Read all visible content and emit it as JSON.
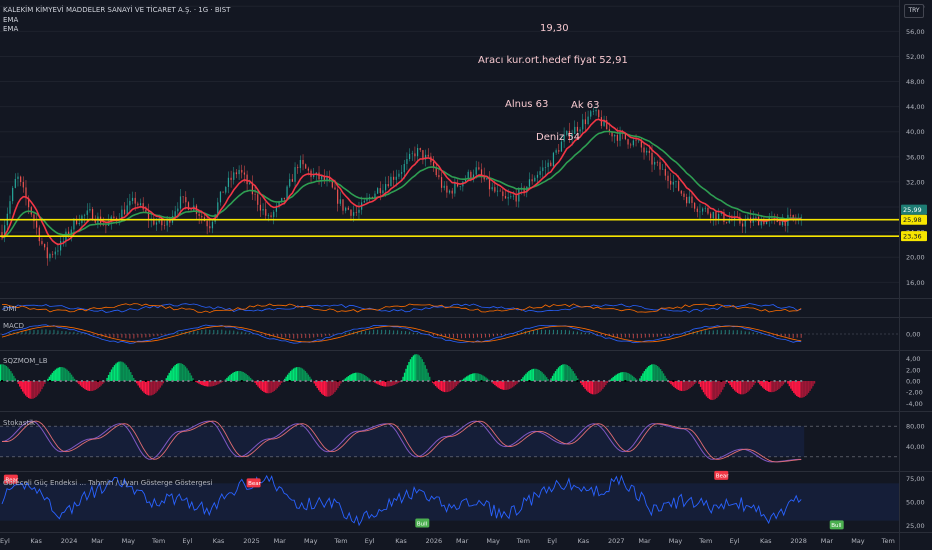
{
  "header": {
    "title": "KALEKİM KİMYEVİ MADDELER SANAYİ VE TİCARET A.Ş. · 1G · BIST",
    "indicators": [
      "EMA",
      "EMA"
    ],
    "currency": "TRY"
  },
  "annotations": [
    {
      "id": "price-note",
      "text": "19,30"
    },
    {
      "id": "target-note",
      "text": "Aracı kur.ort.hedef fiyat 52,91"
    },
    {
      "id": "alnus-note",
      "text": "Alnus 63"
    },
    {
      "id": "ak-note",
      "text": "Ak 63"
    },
    {
      "id": "deniz-note",
      "text": "Deniz 54"
    }
  ],
  "panes": {
    "dmi": "DMI",
    "macd": "MACD",
    "sqzmom": "SQZMOM_LB",
    "stoch": "Stokastik",
    "rsi": "Göreceli Güç Endeksi ... Tahmin / Uyarı Gösterge Göstergesi"
  },
  "colors": {
    "background": "#131722",
    "candle_up": "#26a69a",
    "candle_down": "#ef5350",
    "ema_fast": "#f23645",
    "ema_slow": "#2e9e52",
    "support": "#f7e600",
    "macd_line": "#2962ff",
    "signal_line": "#ff6d00",
    "sqz_up": "#00e676",
    "sqz_down": "#ff1744",
    "stoch_k": "#7e57c2",
    "stoch_d": "#e06c72",
    "rsi_line": "#2962ff"
  },
  "chart_data": [
    {
      "type": "candlestick",
      "pane": "price",
      "title": "KALEKİM KİMYEVİ MADDELER SANAYİ VE TİCARET A.Ş. · 1G · BIST",
      "x_ticks": [
        "Eyl",
        "Kas",
        "2024",
        "Mar",
        "May",
        "Tem",
        "Eyl",
        "Kas",
        "2025",
        "Mar",
        "May",
        "Tem",
        "Eyl",
        "Kas",
        "2026",
        "Mar",
        "May",
        "Tem",
        "Eyl",
        "Kas",
        "2027",
        "Mar",
        "May",
        "Tem",
        "Eyl",
        "Kas",
        "2028",
        "Mar",
        "May",
        "Tem"
      ],
      "y_ticks": [
        "60,00",
        "56,00",
        "52,00",
        "48,00",
        "44,00",
        "40,00",
        "36,00",
        "32,00",
        "28,00",
        "24,00",
        "20,00",
        "16,00"
      ],
      "ylim": [
        13.5,
        61
      ],
      "price_path_month_index": [
        0,
        0.5,
        1,
        1.5,
        2,
        2.5,
        3,
        3.5,
        4,
        4.5,
        5,
        5.5,
        6,
        6.5,
        7,
        7.5,
        8,
        8.5,
        9,
        9.5,
        10,
        10.5,
        11,
        11.5,
        12,
        12.5,
        13,
        13.5,
        14,
        14.5,
        15,
        15.5,
        16,
        16.5,
        17,
        17.5,
        18,
        18.5,
        19,
        19.5,
        20,
        20.5,
        21,
        21.5,
        22,
        22.5,
        23,
        23.5,
        24,
        24.5,
        25,
        25.5,
        26,
        26.5,
        27
      ],
      "price_path_values": [
        24,
        33,
        27,
        20,
        22,
        26,
        27,
        25,
        27,
        29,
        26,
        25,
        29,
        28,
        25,
        31,
        34,
        30,
        26,
        29,
        35,
        33,
        32,
        28,
        27,
        30,
        32,
        34,
        37,
        35,
        30,
        32,
        34,
        31,
        29,
        30,
        33,
        35,
        39,
        41,
        43,
        40,
        39,
        38,
        35,
        33,
        30,
        28,
        27,
        26,
        25.5,
        25.98,
        25.8,
        25.9,
        25.98
      ],
      "series": [
        {
          "name": "EMA",
          "color": "#f23645"
        },
        {
          "name": "EMA",
          "color": "#2e9e52"
        }
      ],
      "horizontal_lines": [
        {
          "value": 25.98,
          "label": "25,98",
          "color": "#f7e600"
        },
        {
          "value": 23.36,
          "label": "23,36",
          "color": "#f7e600"
        }
      ],
      "last_price": {
        "value": 25.99,
        "label": "25,99"
      },
      "annotation_position": "top-center"
    },
    {
      "type": "line",
      "pane": "dmi",
      "title": "DMI",
      "series": [
        {
          "color": "#2962ff"
        },
        {
          "color": "#ff6d00"
        }
      ]
    },
    {
      "type": "line",
      "pane": "macd",
      "title": "MACD",
      "y_ticks": [
        "0,00"
      ],
      "zero_line": 0
    },
    {
      "type": "bar",
      "pane": "sqzmom",
      "title": "SQZMOM_LB",
      "y_ticks": [
        "4,00",
        "2,00",
        "0,00",
        "-2,00",
        "-4,00"
      ],
      "ylim": [
        -5,
        5
      ],
      "month_index": [
        0,
        1,
        2,
        3,
        4,
        5,
        6,
        7,
        8,
        9,
        10,
        11,
        12,
        13,
        14,
        15,
        16,
        17,
        18,
        19,
        20,
        21,
        22,
        23,
        24,
        25,
        26,
        27
      ],
      "values": [
        3,
        -3.2,
        2.5,
        -1.8,
        3.5,
        -2.6,
        3.2,
        -1,
        1.8,
        -2.2,
        2.5,
        -2.8,
        1.5,
        -1,
        4.8,
        -2,
        1.4,
        -1.6,
        2.2,
        3,
        -2.4,
        1.6,
        3,
        -1.8,
        -3.4,
        -2.4,
        -2,
        -3
      ]
    },
    {
      "type": "line",
      "pane": "stoch",
      "title": "Stokastik",
      "y_ticks": [
        "80,00",
        "40,00"
      ],
      "ylim": [
        0,
        100
      ],
      "band": [
        20,
        80
      ],
      "month_index": [
        0,
        1,
        2,
        3,
        4,
        5,
        6,
        7,
        8,
        9,
        10,
        11,
        12,
        13,
        14,
        15,
        16,
        17,
        18,
        19,
        20,
        21,
        22,
        23,
        24,
        25,
        26,
        27
      ],
      "values": [
        50,
        90,
        30,
        55,
        85,
        15,
        70,
        90,
        20,
        55,
        85,
        30,
        70,
        85,
        20,
        60,
        90,
        40,
        70,
        45,
        85,
        30,
        85,
        75,
        15,
        35,
        10,
        15
      ]
    },
    {
      "type": "line",
      "pane": "rsi",
      "title": "Göreceli Güç Endeksi ... Tahmin / Uyarı Gösterge Göstergesi",
      "y_ticks": [
        "75,00",
        "50,00",
        "25,00"
      ],
      "ylim": [
        20,
        80
      ],
      "band": [
        30,
        70
      ],
      "month_index": [
        0,
        1,
        2,
        3,
        4,
        5,
        6,
        7,
        8,
        9,
        10,
        11,
        12,
        13,
        14,
        15,
        16,
        17,
        18,
        19,
        20,
        21,
        22,
        23,
        24,
        25,
        26,
        27
      ],
      "values": [
        55,
        70,
        35,
        60,
        72,
        50,
        55,
        40,
        68,
        75,
        45,
        52,
        30,
        48,
        60,
        45,
        50,
        35,
        55,
        70,
        60,
        74,
        40,
        52,
        45,
        48,
        32,
        55
      ],
      "markers": [
        {
          "label": "Bear",
          "month_index": 0.3,
          "value": 74
        },
        {
          "label": "Bear",
          "month_index": 8.5,
          "value": 70
        },
        {
          "label": "Bull",
          "month_index": 14.2,
          "value": 27
        },
        {
          "label": "Bear",
          "month_index": 24.3,
          "value": 78
        },
        {
          "label": "Bull",
          "month_index": 28.2,
          "value": 25
        }
      ]
    }
  ]
}
